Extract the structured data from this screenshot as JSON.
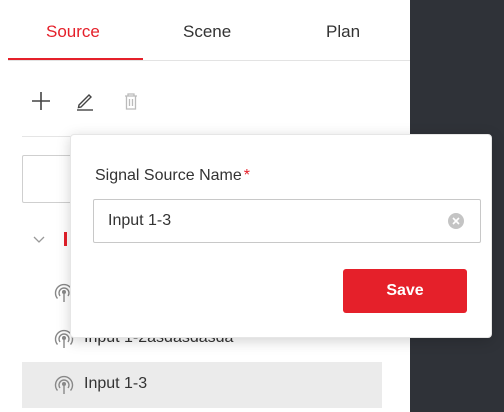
{
  "tabs": [
    {
      "label": "Source",
      "active": true
    },
    {
      "label": "Scene",
      "active": false
    },
    {
      "label": "Plan",
      "active": false
    }
  ],
  "toolbar": {
    "icons": [
      "plus-icon",
      "edit-icon",
      "delete-icon"
    ]
  },
  "tree": {
    "items": [
      {
        "label": "Input 1-2asdasdasda",
        "selected": false,
        "icon": "signal-source-icon"
      },
      {
        "label": "Input 1-3",
        "selected": true,
        "icon": "signal-source-icon"
      }
    ]
  },
  "dialog": {
    "label": "Signal Source Name",
    "required_mark": "*",
    "input_value": "Input 1-3",
    "save_label": "Save"
  },
  "colors": {
    "accent": "#e5202a",
    "dark_panel": "#2f3238",
    "selected_row": "#ebebeb"
  }
}
